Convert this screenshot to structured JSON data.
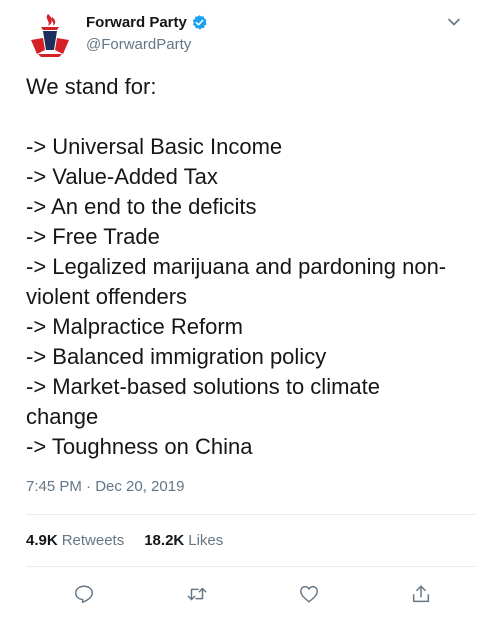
{
  "author": {
    "name": "Forward Party",
    "handle": "@ForwardParty",
    "verified_icon": "verified-badge-icon",
    "avatar_icon": "torch-logo-icon"
  },
  "tweet": {
    "text": "We stand for:\n\n-> Universal Basic Income\n-> Value-Added Tax\n-> An end to the deficits\n-> Free Trade\n-> Legalized marijuana and pardoning non-violent offenders\n-> Malpractice Reform\n-> Balanced immigration policy\n-> Market-based solutions to climate change\n-> Toughness on China",
    "timestamp": "7:45 PM · Dec 20, 2019"
  },
  "stats": {
    "retweets_count": "4.9K",
    "retweets_label": "Retweets",
    "likes_count": "18.2K",
    "likes_label": "Likes"
  },
  "actions": [
    "reply-icon",
    "retweet-icon",
    "like-icon",
    "share-icon"
  ],
  "colors": {
    "text": "#14171a",
    "secondary": "#657786",
    "accent": "#1da1f2",
    "logo_red": "#d42027",
    "logo_navy": "#1c2e5c"
  }
}
